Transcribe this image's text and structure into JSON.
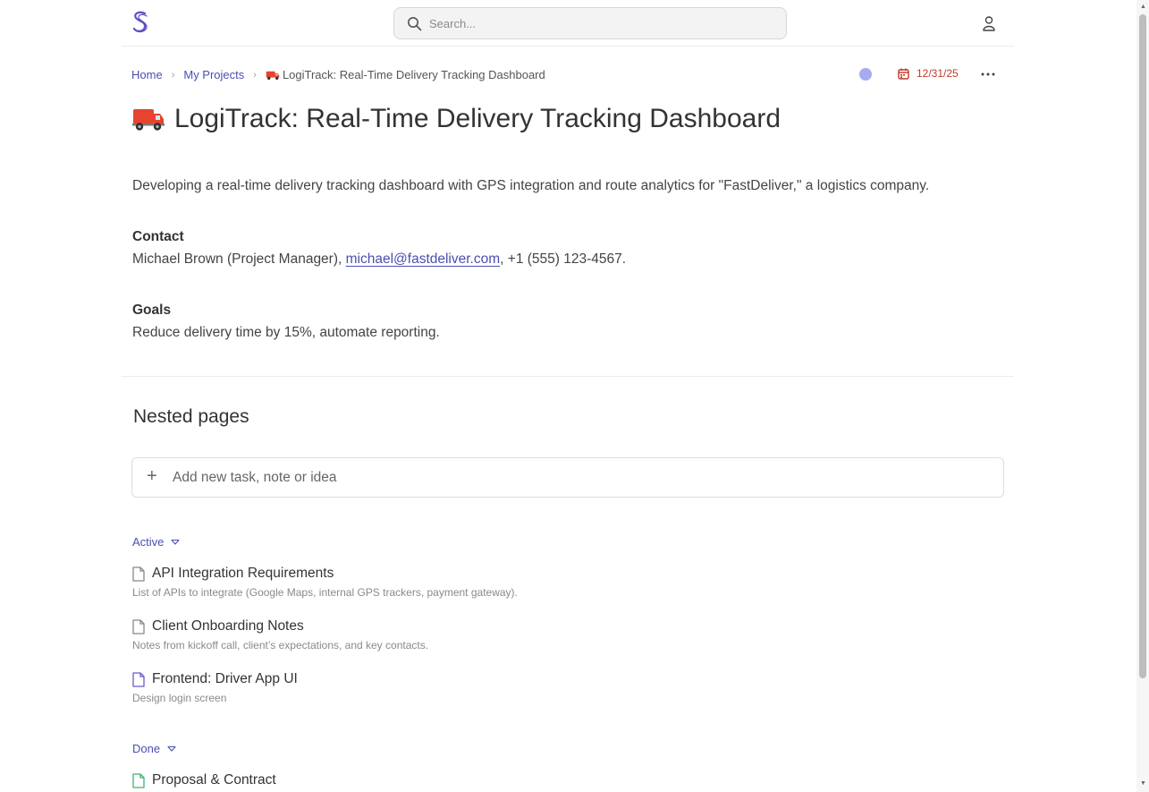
{
  "header": {
    "search_placeholder": "Search...",
    "logo_icon": "s-logo-icon",
    "user_icon": "user-icon"
  },
  "breadcrumb": {
    "home": "Home",
    "projects": "My Projects",
    "current": "LogiTrack: Real-Time Delivery Tracking Dashboard"
  },
  "meta": {
    "status_color": "#a8abef",
    "due_date": "12/31/25",
    "date_color": "#c0392b"
  },
  "page": {
    "title": "LogiTrack: Real-Time Delivery Tracking Dashboard",
    "description": "Developing a real-time delivery tracking dashboard with GPS integration and route analytics for \"FastDeliver,\" a logistics company.",
    "contact_label": "Contact",
    "contact_name": "Michael Brown (Project Manager), ",
    "contact_email": "michael@fastdeliver.com",
    "contact_phone": ", +1 (555) 123-4567.",
    "goals_label": "Goals",
    "goals_text": "Reduce delivery time by 15%, automate reporting."
  },
  "nested": {
    "heading": "Nested pages",
    "add_placeholder": "Add new task, note or idea",
    "active_label": "Active",
    "done_label": "Done",
    "active_items": [
      {
        "title": "API Integration Requirements",
        "subtitle": "List of APIs to integrate (Google Maps, internal GPS trackers, payment gateway).",
        "icon_color": "#888888"
      },
      {
        "title": "Client Onboarding Notes",
        "subtitle": "Notes from kickoff call, client’s expectations, and key contacts.",
        "icon_color": "#888888"
      },
      {
        "title": "Frontend: Driver App UI",
        "subtitle": "Design login screen",
        "icon_color": "#6a5acd"
      }
    ],
    "done_items": [
      {
        "title": "Proposal & Contract",
        "icon_color": "#3cb371"
      }
    ]
  },
  "colors": {
    "accent": "#4b4fb0"
  }
}
